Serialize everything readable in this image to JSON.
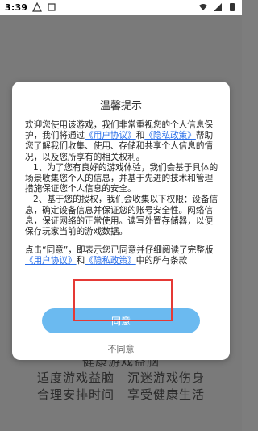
{
  "status_bar": {
    "time": "3:39",
    "icons": [
      "notification-icon-a",
      "notification-icon-b",
      "wifi-icon",
      "signal-icon",
      "battery-icon"
    ]
  },
  "background": {
    "line0": "健康游戏益脑",
    "line1": "适度游戏益脑　沉迷游戏伤身",
    "line2": "合理安排时间　享受健康生活"
  },
  "dialog": {
    "title": "温馨提示",
    "para1_prefix": "欢迎您使用该游戏，我们非常重视您的个人信息保护，我们将通过",
    "para1_link1": "《用户协议》",
    "para1_mid": "和",
    "para1_link2": "《隐私政策》",
    "para1_suffix": "帮助您了解我们收集、使用、存储和共享个人信息的情况，以及您所享有的相关权利。",
    "para2": "1、为了您有良好的游戏体验，我们会基于具体的场景收集您个人的信息，并基于先进的技术和管理措施保证您个人信息的安全。",
    "para3": "2、基于您的授权，我们会收集以下权限：设备信息，确定设备信息并保证您的账号安全性。网络信息，保证网络的正常使用。读写外置存储器，以便保存玩家当前的游戏数据。",
    "para4_prefix": "点击“同意”，即表示您已同意并仔细阅读了完整版",
    "para4_link1": "《用户协议》",
    "para4_mid": "和",
    "para4_link2": "《隐私政策》",
    "para4_suffix": "中的所有条款",
    "agree_label": "同意",
    "decline_label": "不同意"
  },
  "colors": {
    "agree_button": "#6bbaf0",
    "link": "#2a6ee8",
    "annotation": "#e53935"
  }
}
